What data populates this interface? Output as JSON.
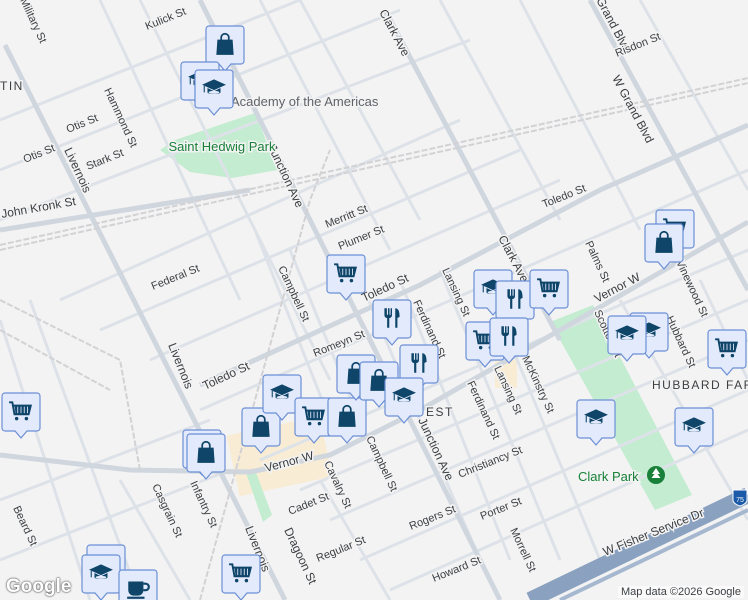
{
  "map": {
    "streets": {
      "livernois": "Livernois",
      "junction": "Junction Ave",
      "clark": "Clark Ave",
      "grand": "W Grand Blvd",
      "grand2": "Grand Blvd",
      "vernor": "Vernor W",
      "toledo": "Toledo St",
      "kronk": "John Kronk St",
      "otis": "Otis St",
      "stark": "Stark St",
      "hammond": "Hammond St",
      "kulick": "Kulick St",
      "military": "Military St",
      "federal": "Federal St",
      "merritt": "Merritt St",
      "plumer": "Plumer St",
      "campbell": "Campbell St",
      "romeyn": "Romeyn St",
      "ferdinand": "Ferdinand St",
      "lansing": "Lansing St",
      "mckinstry": "McKinstry St",
      "christiancy": "Christiancy St",
      "porter": "Porter St",
      "rogers": "Rogers St",
      "howard": "Howard St",
      "morrell": "Morrell St",
      "cavalry": "Cavalry St",
      "cadet": "Cadet St",
      "regular": "Regular St",
      "dragoon": "Dragoon St",
      "infantry": "Infantry St",
      "casgrain": "Casgrain St",
      "beard": "Beard St",
      "toledo_e": "Toledo St",
      "palms": "Palms St",
      "risdon": "Risdon St",
      "scotten": "Scotten St",
      "hubbard": "Hubbard St",
      "vinewood": "Vinewood St",
      "fisher": "W Fisher Service Dr",
      "i75": "75"
    },
    "places": {
      "academy": "Academy of the Americas",
      "st_hedwig": "Saint Hedwig Park",
      "clark_park": "Clark Park",
      "hubbard_farms": "HUBBARD FARMS",
      "west": "EST",
      "tin": "TIN"
    },
    "markers": [
      "shopping-bag",
      "graduation-cap",
      "graduation-cap",
      "shopping-cart",
      "restaurant",
      "graduation-cap",
      "restaurant",
      "shopping-cart",
      "shopping-cart",
      "shopping-bag",
      "graduation-cap",
      "graduation-cap",
      "shopping-cart",
      "graduation-cap",
      "graduation-cap",
      "shopping-cart",
      "shopping-bag",
      "shopping-bag",
      "graduation-cap",
      "shopping-cart",
      "shopping-bag",
      "shopping-cart",
      "restaurant",
      "shopping-bag",
      "shopping-bag",
      "restaurant",
      "graduation-cap",
      "shopping-bag",
      "graduation-cap",
      "graduation-cap",
      "coffee-cup",
      "shopping-cart"
    ],
    "colors": {
      "marker_fill": "#e3eafb",
      "marker_border": "#6b8fd6",
      "icon": "#0e4569",
      "park": "#c3ecd1",
      "highway": "#8aa2c0",
      "road": "#d7dde4"
    },
    "footer": {
      "logo": "Google",
      "credit": "Map data ©2026 Google"
    }
  }
}
